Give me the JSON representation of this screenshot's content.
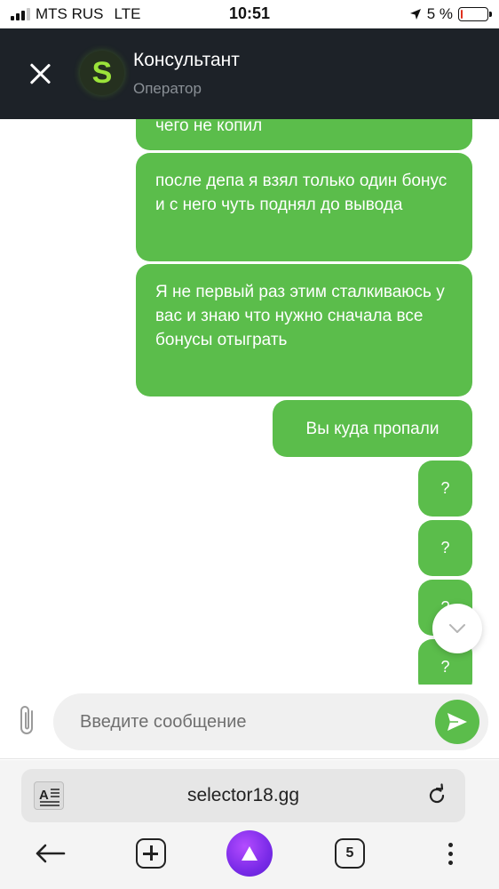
{
  "status_bar": {
    "carrier": "MTS RUS",
    "network": "LTE",
    "time": "10:51",
    "battery_percent": "5 %",
    "battery_level": 0.05,
    "battery_color": "#e0301e"
  },
  "chat": {
    "title": "Консультант",
    "subtitle": "Оператор",
    "avatar_letter": "S",
    "accent_color": "#5bbd4b",
    "header_color": "#1d2228",
    "messages": [
      {
        "text": "чего не копил"
      },
      {
        "text": "после депа я взял только один бонус и с него чуть поднял до вывода"
      },
      {
        "text": "Я не первый раз этим сталкиваюсь у вас и знаю что нужно сначала все бонусы отыграть"
      },
      {
        "text": "Вы куда пропали"
      },
      {
        "text": "?"
      },
      {
        "text": "?"
      },
      {
        "text": "?"
      },
      {
        "text": "?"
      }
    ]
  },
  "composer": {
    "placeholder": "Введите сообщение",
    "attach_icon": "paperclip-icon",
    "send_icon": "send-icon"
  },
  "browser": {
    "url": "selector18.gg",
    "tab_count": "5",
    "icons": [
      "back-arrow-icon",
      "new-tab-icon",
      "alice-assistant-icon",
      "tabs-icon",
      "more-icon"
    ]
  }
}
